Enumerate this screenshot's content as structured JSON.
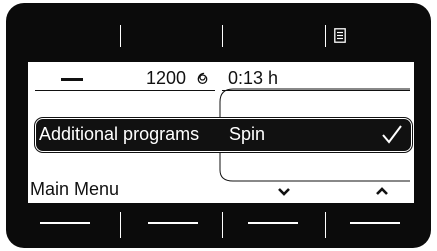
{
  "header": {
    "spin_speed": "1200",
    "spin_icon": "spiral-spin-icon",
    "remaining_time": "0:13 h",
    "menu_icon": "document-list-icon",
    "minus_icon": "minus-icon"
  },
  "selection": {
    "label": "Additional programs",
    "value": "Spin",
    "check_icon": "checkmark-icon"
  },
  "footer": {
    "main_menu_label": "Main Menu",
    "down_icon": "chevron-down-icon",
    "up_icon": "chevron-up-icon"
  },
  "colors": {
    "bezel": "#0b0b0b",
    "lcd_background": "#ffffff",
    "lcd_text": "#111111"
  }
}
